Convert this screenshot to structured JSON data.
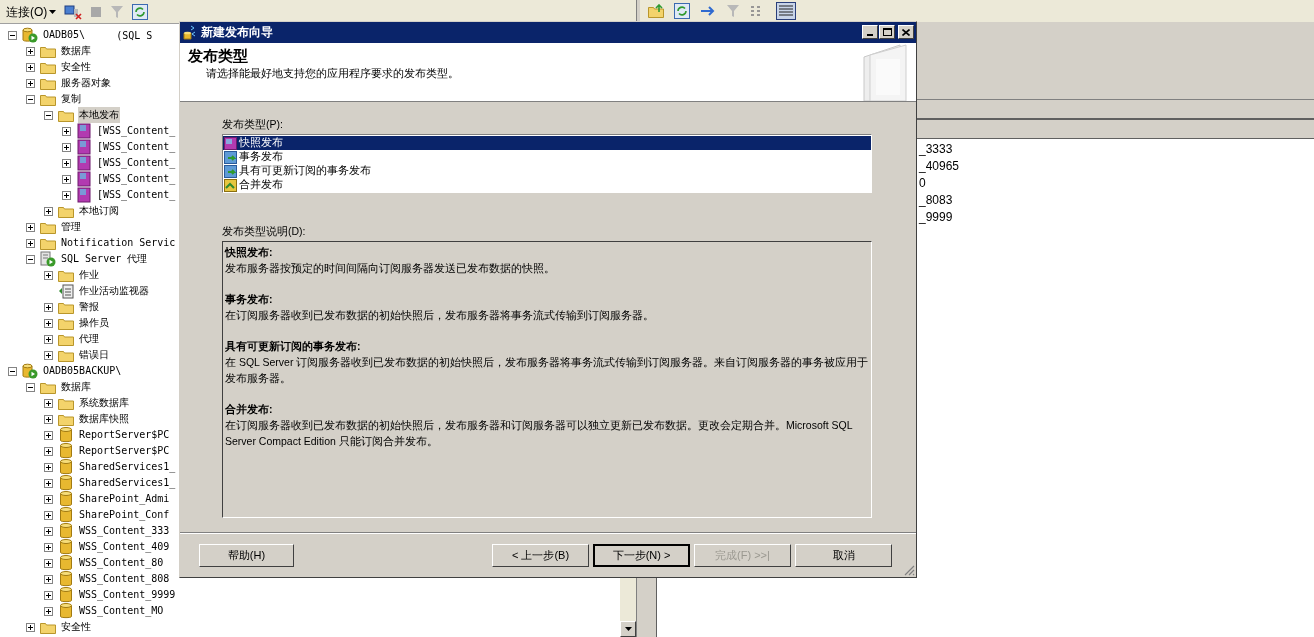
{
  "toolbar": {
    "connect_label": "连接(O)"
  },
  "tree": [
    {
      "label": "OADB05\\",
      "label_2": "(SQL S",
      "kind": "server",
      "expanded": true,
      "selected": false,
      "children": [
        {
          "label": "数据库",
          "kind": "folder",
          "expanded": false,
          "selected": false
        },
        {
          "label": "安全性",
          "kind": "folder",
          "expanded": false,
          "selected": false
        },
        {
          "label": "服务器对象",
          "kind": "folder",
          "expanded": false,
          "selected": false
        },
        {
          "label": "复制",
          "kind": "folder",
          "expanded": true,
          "selected": false,
          "children": [
            {
              "label": "本地发布",
              "kind": "folder",
              "expanded": true,
              "selected": true,
              "children": [
                {
                  "label": "[WSS_Content_",
                  "kind": "publication",
                  "expanded": false,
                  "selected": false
                },
                {
                  "label": "[WSS_Content_",
                  "kind": "publication",
                  "expanded": false,
                  "selected": false
                },
                {
                  "label": "[WSS_Content_",
                  "kind": "publication",
                  "expanded": false,
                  "selected": false
                },
                {
                  "label": "[WSS_Content_",
                  "kind": "publication",
                  "expanded": false,
                  "selected": false
                },
                {
                  "label": "[WSS_Content_",
                  "kind": "publication",
                  "expanded": false,
                  "selected": false
                }
              ]
            },
            {
              "label": "本地订阅",
              "kind": "folder",
              "expanded": false,
              "selected": false
            }
          ]
        },
        {
          "label": "管理",
          "kind": "folder",
          "expanded": false,
          "selected": false
        },
        {
          "label": "Notification Servic",
          "kind": "folder",
          "expanded": false,
          "selected": false
        },
        {
          "label": "SQL Server 代理",
          "kind": "agent",
          "expanded": true,
          "selected": false,
          "children": [
            {
              "label": "作业",
              "kind": "folder",
              "expanded": false,
              "selected": false
            },
            {
              "label": "作业活动监视器",
              "kind": "monitor",
              "selected": false
            },
            {
              "label": "警报",
              "kind": "folder",
              "expanded": false,
              "selected": false
            },
            {
              "label": "操作员",
              "kind": "folder",
              "expanded": false,
              "selected": false
            },
            {
              "label": "代理",
              "kind": "folder",
              "expanded": false,
              "selected": false
            },
            {
              "label": "错误日",
              "kind": "folder",
              "expanded": false,
              "selected": false
            }
          ]
        }
      ]
    },
    {
      "label": "OADB05BACKUP\\",
      "kind": "server",
      "expanded": true,
      "selected": false,
      "children": [
        {
          "label": "数据库",
          "kind": "folder",
          "expanded": true,
          "selected": false,
          "children": [
            {
              "label": "系统数据库",
              "kind": "folder",
              "expanded": false,
              "selected": false
            },
            {
              "label": "数据库快照",
              "kind": "folder",
              "expanded": false,
              "selected": false
            },
            {
              "label": "ReportServer$PC",
              "kind": "database",
              "expanded": false,
              "selected": false
            },
            {
              "label": "ReportServer$PC",
              "kind": "database",
              "expanded": false,
              "selected": false
            },
            {
              "label": "SharedServices1_",
              "kind": "database",
              "expanded": false,
              "selected": false
            },
            {
              "label": "SharedServices1_",
              "kind": "database",
              "expanded": false,
              "selected": false
            },
            {
              "label": "SharePoint_Admi",
              "kind": "database",
              "expanded": false,
              "selected": false
            },
            {
              "label": "SharePoint_Conf",
              "kind": "database",
              "expanded": false,
              "selected": false
            },
            {
              "label": "WSS_Content_333",
              "kind": "database",
              "expanded": false,
              "selected": false
            },
            {
              "label": "WSS_Content_409",
              "kind": "database",
              "expanded": false,
              "selected": false
            },
            {
              "label": "WSS_Content_80",
              "kind": "database",
              "expanded": false,
              "selected": false
            },
            {
              "label": "WSS_Content_808",
              "kind": "database",
              "expanded": false,
              "selected": false
            },
            {
              "label": "WSS_Content_9999",
              "kind": "database",
              "expanded": false,
              "selected": false
            },
            {
              "label": "WSS_Content_MO",
              "kind": "database",
              "expanded": false,
              "selected": false
            }
          ]
        },
        {
          "label": "安全性",
          "kind": "folder",
          "expanded": false,
          "selected": false
        }
      ]
    }
  ],
  "wizard": {
    "title": "新建发布向导",
    "heading": "发布类型",
    "subheading": "请选择能最好地支持您的应用程序要求的发布类型。",
    "types_label": "发布类型(P):",
    "publication_types": [
      {
        "label": "快照发布",
        "kind": "snapshot",
        "selected": true
      },
      {
        "label": "事务发布",
        "kind": "transactional",
        "selected": false
      },
      {
        "label": "具有可更新订阅的事务发布",
        "kind": "transactional",
        "selected": false
      },
      {
        "label": "合并发布",
        "kind": "merge",
        "selected": false
      }
    ],
    "description_label": "发布类型说明(D):",
    "descriptions": [
      {
        "title": "快照发布:",
        "text": "发布服务器按预定的时间间隔向订阅服务器发送已发布数据的快照。"
      },
      {
        "title": "事务发布:",
        "text": "在订阅服务器收到已发布数据的初始快照后，发布服务器将事务流式传输到订阅服务器。"
      },
      {
        "title": "具有可更新订阅的事务发布:",
        "text": "在 SQL Server 订阅服务器收到已发布数据的初始快照后，发布服务器将事务流式传输到订阅服务器。来自订阅服务器的事务被应用于发布服务器。"
      },
      {
        "title": "合并发布:",
        "text": "在订阅服务器收到已发布数据的初始快照后，发布服务器和订阅服务器可以独立更新已发布数据。更改会定期合并。Microsoft SQL Server Compact Edition 只能订阅合并发布。"
      }
    ],
    "buttons": [
      {
        "label": "帮助(H)",
        "kind": "help",
        "default": false,
        "disabled": false
      },
      {
        "label": "< 上一步(B)",
        "kind": "nav",
        "default": false,
        "disabled": false
      },
      {
        "label": "下一步(N) >",
        "kind": "nav",
        "default": true,
        "disabled": false
      },
      {
        "label": "完成(F) >>|",
        "kind": "nav",
        "default": false,
        "disabled": true
      },
      {
        "label": "取消",
        "kind": "nav",
        "default": false,
        "disabled": false
      }
    ]
  },
  "details": {
    "rows": [
      "_3333",
      "_40965",
      "0",
      "_8083",
      "_9999"
    ]
  }
}
